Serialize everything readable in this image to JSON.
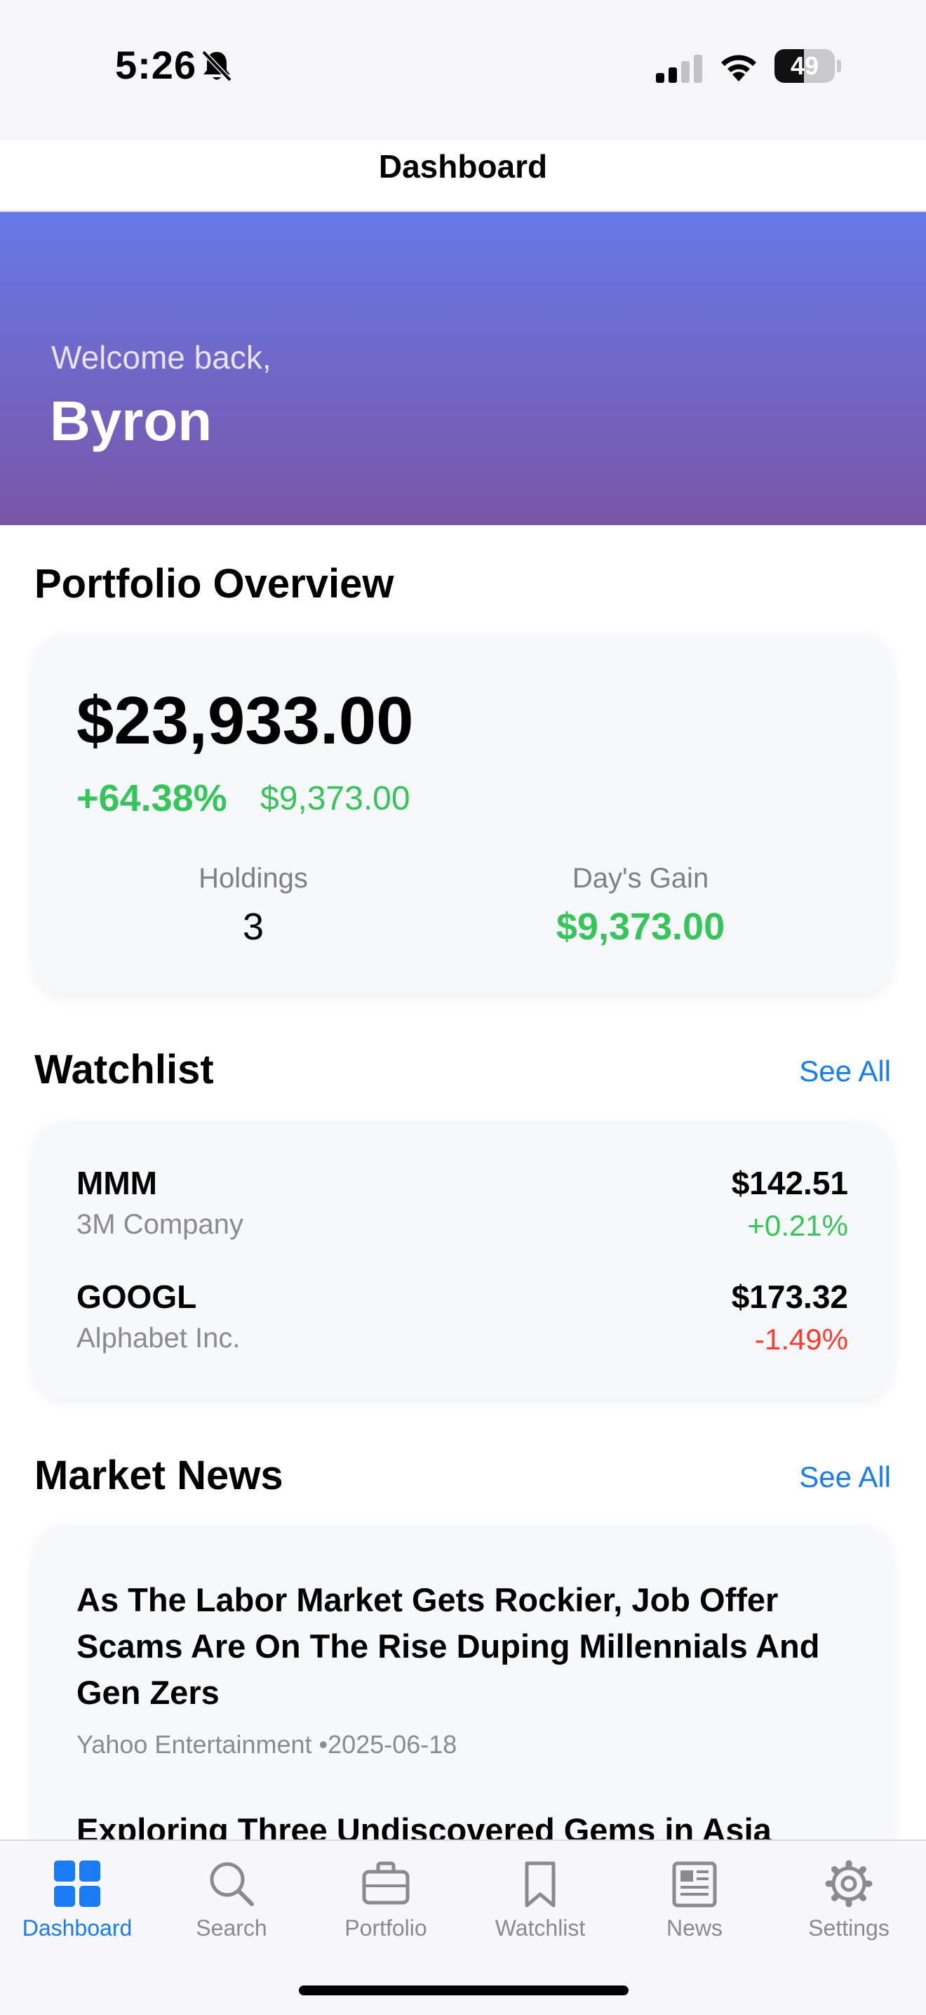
{
  "status_bar": {
    "time": "5:26",
    "battery": "49",
    "battery_level": 0.49
  },
  "nav": {
    "title": "Dashboard"
  },
  "hero": {
    "greeting": "Welcome back,",
    "name": "Byron"
  },
  "portfolio": {
    "section_title": "Portfolio Overview",
    "total_value": "$23,933.00",
    "percent_change": "+64.38%",
    "amount_change": "$9,373.00",
    "holdings_label": "Holdings",
    "holdings_value": "3",
    "days_gain_label": "Day's Gain",
    "days_gain_value": "$9,373.00"
  },
  "watchlist": {
    "section_title": "Watchlist",
    "see_all": "See All",
    "items": [
      {
        "symbol": "MMM",
        "name": "3M Company",
        "price": "$142.51",
        "change": "+0.21%",
        "color": "#35c55a"
      },
      {
        "symbol": "GOOGL",
        "name": "Alphabet Inc.",
        "price": "$173.32",
        "change": "-1.49%",
        "color": "#ff3b30"
      }
    ]
  },
  "news": {
    "section_title": "Market News",
    "see_all": "See All",
    "items": [
      {
        "title": "As The Labor Market Gets Rockier, Job Offer Scams Are On The Rise Duping Millennials And Gen Zers",
        "meta": "Yahoo Entertainment •2025-06-18"
      },
      {
        "title": "Exploring Three Undiscovered Gems in Asia"
      }
    ]
  },
  "tabs": [
    {
      "label": "Dashboard",
      "icon": "grid-icon",
      "active": true
    },
    {
      "label": "Search",
      "icon": "search-icon"
    },
    {
      "label": "Portfolio",
      "icon": "briefcase-icon"
    },
    {
      "label": "Watchlist",
      "icon": "bookmark-icon"
    },
    {
      "label": "News",
      "icon": "newspaper-icon"
    },
    {
      "label": "Settings",
      "icon": "gear-icon"
    }
  ],
  "colors": {
    "accent": "#1a7cf5",
    "positive": "#35c55a",
    "negative": "#ff3b30",
    "hero_top": "#6679e6",
    "hero_bottom": "#7a55a8"
  }
}
